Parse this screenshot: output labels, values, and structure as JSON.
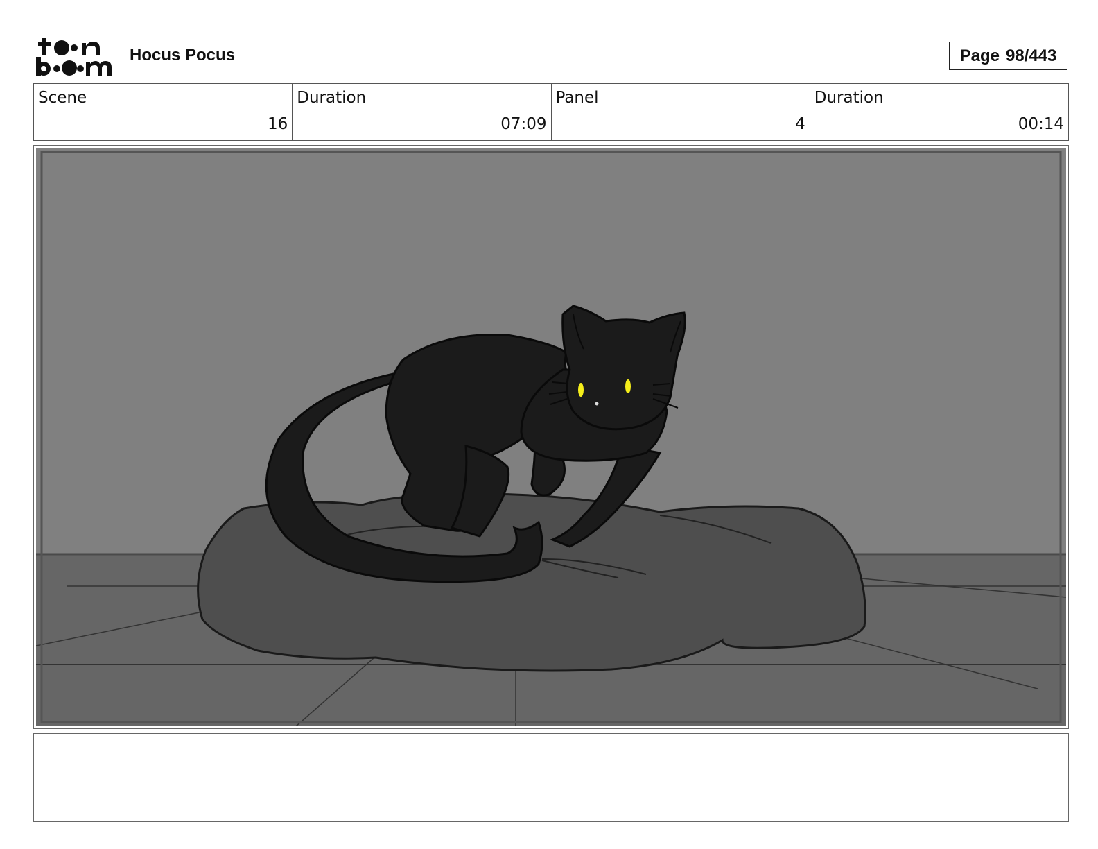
{
  "header": {
    "logo_text": "toon boom",
    "title": "Hocus Pocus",
    "page_label": "Page",
    "page_value": "98/443"
  },
  "info": [
    {
      "label": "Scene",
      "value": "16"
    },
    {
      "label": "Duration",
      "value": "07:09"
    },
    {
      "label": "Panel",
      "value": "4"
    },
    {
      "label": "Duration",
      "value": "00:14"
    }
  ],
  "panel": {
    "image_subject": "black-cat-on-cushion",
    "colors": {
      "wall": "#808080",
      "floor": "#666666",
      "cushion": "#4e4e4e",
      "cat": "#1b1b1b",
      "eyes": "#f5ee1a"
    }
  },
  "notes": {
    "text": ""
  }
}
